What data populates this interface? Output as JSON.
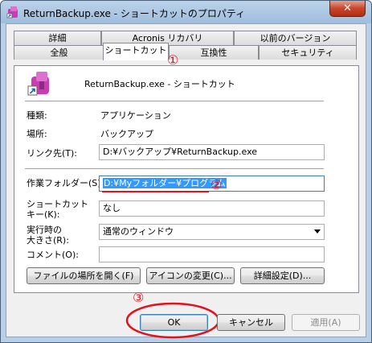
{
  "window": {
    "title": "ReturnBackup.exe - ショートカットのプロパティ",
    "close_glyph": "✕"
  },
  "tabs_row1": [
    {
      "label": "詳細"
    },
    {
      "label": "Acronis リカバリ"
    },
    {
      "label": "以前のバージョン"
    }
  ],
  "tabs_row2": [
    {
      "label": "全般"
    },
    {
      "label": "ショートカット"
    },
    {
      "label": "互換性"
    },
    {
      "label": "セキュリティ"
    }
  ],
  "header": {
    "name": "ReturnBackup.exe - ショートカット"
  },
  "fields": {
    "type_label": "種類:",
    "type_value": "アプリケーション",
    "location_label": "場所:",
    "location_value": "バックアップ",
    "target_label": "リンク先(T):",
    "target_value": "D:¥バックアップ¥ReturnBackup.exe",
    "startin_label": "作業フォルダー(S):",
    "startin_value": "D:¥Myフォルダー¥プログラム",
    "shortcut_label_1": "ショートカット",
    "shortcut_label_2": "キー(K):",
    "shortcut_value": "なし",
    "run_label_1": "実行時の",
    "run_label_2": "大きさ(R):",
    "run_value": "通常のウィンドウ",
    "comment_label": "コメント(O):",
    "comment_value": ""
  },
  "buttons": {
    "open_location": "ファイルの場所を開く(F)",
    "change_icon": "アイコンの変更(C)...",
    "advanced": "詳細設定(D)...",
    "ok": "OK",
    "cancel": "キャンセル",
    "apply": "適用(A)"
  },
  "annotations": {
    "mark1": "①",
    "mark2": "②",
    "mark3": "③"
  },
  "colors": {
    "annotation_red": "#e0141e",
    "selection_blue": "#3399ff"
  }
}
